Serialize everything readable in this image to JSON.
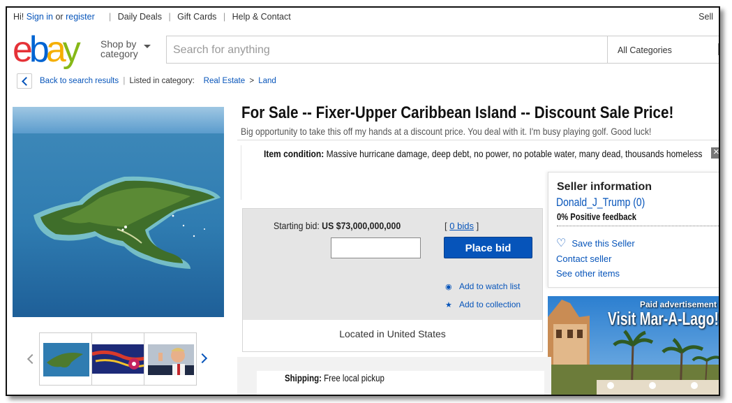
{
  "topnav": {
    "greeting": "Hi!",
    "sign_in": "Sign in",
    "or": "or",
    "register": "register",
    "links": [
      "Daily Deals",
      "Gift Cards",
      "Help & Contact"
    ],
    "sell": "Sell"
  },
  "header": {
    "logo": [
      "e",
      "b",
      "a",
      "y"
    ],
    "shop_by_line1": "Shop by",
    "shop_by_line2": "category",
    "search_placeholder": "Search for anything",
    "category_select": "All Categories"
  },
  "breadcrumb": {
    "back": "Back to search results",
    "listed_in": "Listed in category:",
    "cat1": "Real Estate",
    "sep": ">",
    "cat2": "Land"
  },
  "listing": {
    "title": "For Sale -- Fixer-Upper Caribbean Island -- Discount Sale Price!",
    "subtitle": "Big opportunity to take this off my hands at a discount price. You deal with it. I'm busy playing golf. Good luck!",
    "condition_label": "Item condition:",
    "condition_value": "Massive hurricane damage, deep debt, no power, no potable water, many dead, thousands homeless",
    "starting_bid_label": "Starting bid:",
    "starting_bid_value": "US $73,000,000,000",
    "bids_open": "[",
    "bids_link": "0 bids",
    "bids_close": "]",
    "place_bid": "Place bid",
    "watch": "Add to watch list",
    "collection": "Add to collection",
    "location": "Located in United States",
    "shipping_label": "Shipping:",
    "shipping_value": "Free local pickup"
  },
  "seller": {
    "heading": "Seller information",
    "name": "Donald_J_Trump (0)",
    "feedback": "0% Positive feedback",
    "save": "Save this Seller",
    "contact": "Contact seller",
    "other": "See other items"
  },
  "ad": {
    "paid": "Paid advertisement",
    "headline": "Visit Mar-A-Lago!"
  },
  "colors": {
    "link": "#0654ba",
    "button": "#0654ba",
    "logo_e": "#e53238",
    "logo_b": "#0064d2",
    "logo_a": "#f5af02",
    "logo_y": "#86b817"
  }
}
